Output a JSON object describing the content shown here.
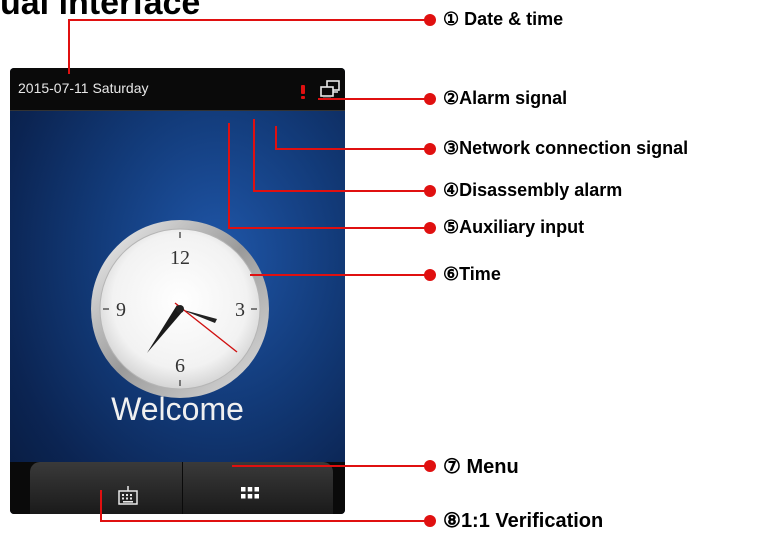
{
  "page_title": "ual interface",
  "device": {
    "date_text": "2015-07-11   Saturday",
    "welcome_text": "Welcome",
    "clock_numerals": [
      "12",
      "3",
      "6",
      "9"
    ],
    "icons": {
      "alarm": "exclamation-icon",
      "network": "network-icon",
      "verification": "keyboard-icon",
      "menu": "grid-menu-icon"
    }
  },
  "callouts": [
    {
      "num": "①",
      "text": " Date & time"
    },
    {
      "num": "②",
      "text": "Alarm signal"
    },
    {
      "num": "③",
      "text": "Network connection signal"
    },
    {
      "num": "④",
      "text": "Disassembly alarm"
    },
    {
      "num": "⑤",
      "text": "Auxiliary input"
    },
    {
      "num": "⑥",
      "text": "Time"
    },
    {
      "num": "⑦",
      "text": " Menu"
    },
    {
      "num": "⑧",
      "text": "1:1 Verification"
    }
  ],
  "colors": {
    "callout_line": "#e01010",
    "status_bar": "#0a0a0a",
    "screen_blue": "#1f56a8"
  }
}
